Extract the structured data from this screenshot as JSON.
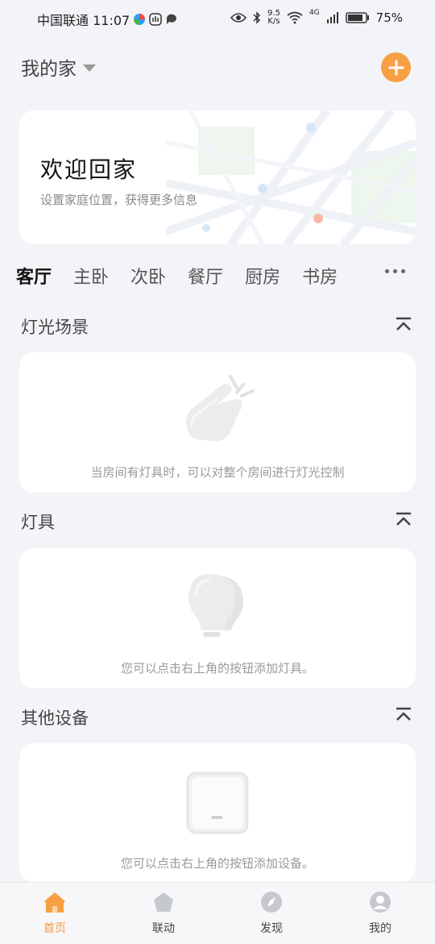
{
  "status_bar": {
    "carrier_time": "中国联通 11:07",
    "speed_value": "9.5",
    "speed_unit": "K/s",
    "network": "4G",
    "battery": "75%"
  },
  "header": {
    "home_name": "我的家"
  },
  "welcome": {
    "title": "欢迎回家",
    "subtitle": "设置家庭位置，获得更多信息"
  },
  "tabs": [
    {
      "label": "客厅",
      "active": true
    },
    {
      "label": "主卧"
    },
    {
      "label": "次卧"
    },
    {
      "label": "餐厅"
    },
    {
      "label": "厨房"
    },
    {
      "label": "书房"
    }
  ],
  "sections": {
    "scenes": {
      "title": "灯光场景",
      "hint": "当房间有灯具时，可以对整个房间进行灯光控制"
    },
    "lights": {
      "title": "灯具",
      "hint": "您可以点击右上角的按钮添加灯具。"
    },
    "devices": {
      "title": "其他设备",
      "hint": "您可以点击右上角的按钮添加设备。"
    }
  },
  "bottom_nav": [
    {
      "label": "首页",
      "icon": "home-icon",
      "active": true
    },
    {
      "label": "联动",
      "icon": "pentagon-icon"
    },
    {
      "label": "发现",
      "icon": "compass-icon"
    },
    {
      "label": "我的",
      "icon": "profile-icon"
    }
  ],
  "colors": {
    "accent": "#f7a043",
    "background": "#f3f4f8"
  }
}
